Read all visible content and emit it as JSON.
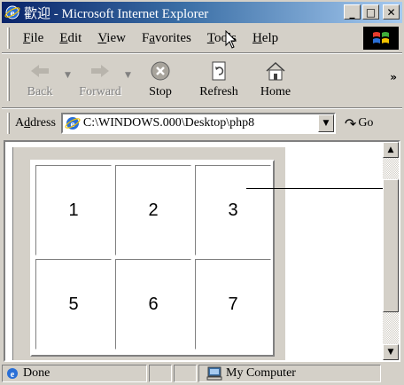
{
  "window": {
    "title": "歡迎 - Microsoft Internet Explorer",
    "controls": {
      "minimize": "_",
      "maximize": "□",
      "close": "✕"
    }
  },
  "menu": {
    "items": [
      {
        "label": "File",
        "accel": "F",
        "rest": "ile"
      },
      {
        "label": "Edit",
        "accel": "E",
        "rest": "dit"
      },
      {
        "label": "View",
        "accel": "V",
        "rest": "iew"
      },
      {
        "label": "Favorites",
        "accel": "a",
        "pre": "F",
        "rest": "vorites"
      },
      {
        "label": "Tools",
        "accel": "T",
        "rest": "ools"
      },
      {
        "label": "Help",
        "accel": "H",
        "rest": "elp"
      }
    ]
  },
  "toolbar": {
    "back": "Back",
    "forward": "Forward",
    "stop": "Stop",
    "refresh": "Refresh",
    "home": "Home",
    "more": "»"
  },
  "address": {
    "label_accel": "d",
    "label_pre": "A",
    "label_rest": "dress",
    "value": "C:\\WINDOWS.000\\Desktop\\php8",
    "go": "Go"
  },
  "content": {
    "cells": [
      "1",
      "2",
      "3",
      "5",
      "6",
      "7"
    ]
  },
  "status": {
    "text": "Done",
    "zone": "My Computer"
  },
  "colors": {
    "title_start": "#0a246a",
    "title_end": "#a6caf0",
    "face": "#d4d0c8"
  }
}
